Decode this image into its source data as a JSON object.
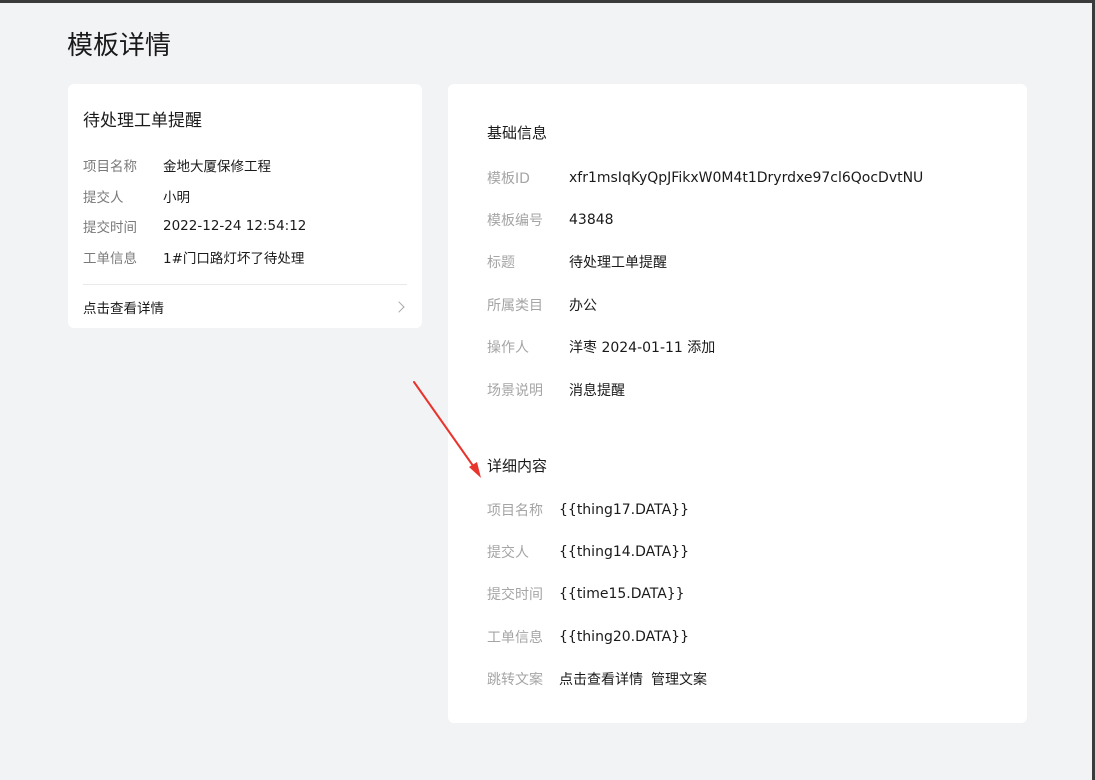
{
  "page": {
    "title": "模板详情"
  },
  "preview": {
    "title": "待处理工单提醒",
    "fields": [
      {
        "label": "项目名称",
        "value": "金地大厦保修工程"
      },
      {
        "label": "提交人",
        "value": "小明"
      },
      {
        "label": "提交时间",
        "value": "2022-12-24 12:54:12"
      },
      {
        "label": "工单信息",
        "value": "1#门口路灯坏了待处理"
      }
    ],
    "detail_link": "点击查看详情"
  },
  "basic_info": {
    "title": "基础信息",
    "fields": [
      {
        "label": "模板ID",
        "value": "xfr1msIqKyQpJFikxW0M4t1Dryrdxe97cl6QocDvtNU"
      },
      {
        "label": "模板编号",
        "value": "43848"
      },
      {
        "label": "标题",
        "value": "待处理工单提醒"
      },
      {
        "label": "所属类目",
        "value": "办公"
      },
      {
        "label": "操作人",
        "value": "洋枣 2024-01-11 添加"
      },
      {
        "label": "场景说明",
        "value": "消息提醒"
      }
    ]
  },
  "detail_content": {
    "title": "详细内容",
    "fields": [
      {
        "label": "项目名称",
        "value": "{{thing17.DATA}}"
      },
      {
        "label": "提交人",
        "value": "{{thing14.DATA}}"
      },
      {
        "label": "提交时间",
        "value": "{{time15.DATA}}"
      },
      {
        "label": "工单信息",
        "value": "{{thing20.DATA}}"
      }
    ],
    "jump": {
      "label": "跳转文案",
      "link1": "点击查看详情",
      "link2": "管理文案"
    }
  },
  "colors": {
    "annotation_arrow": "#e8342c",
    "background": "#f2f3f5",
    "card": "#ffffff"
  },
  "icons": {
    "detail_chevron": "chevron-right-icon"
  }
}
